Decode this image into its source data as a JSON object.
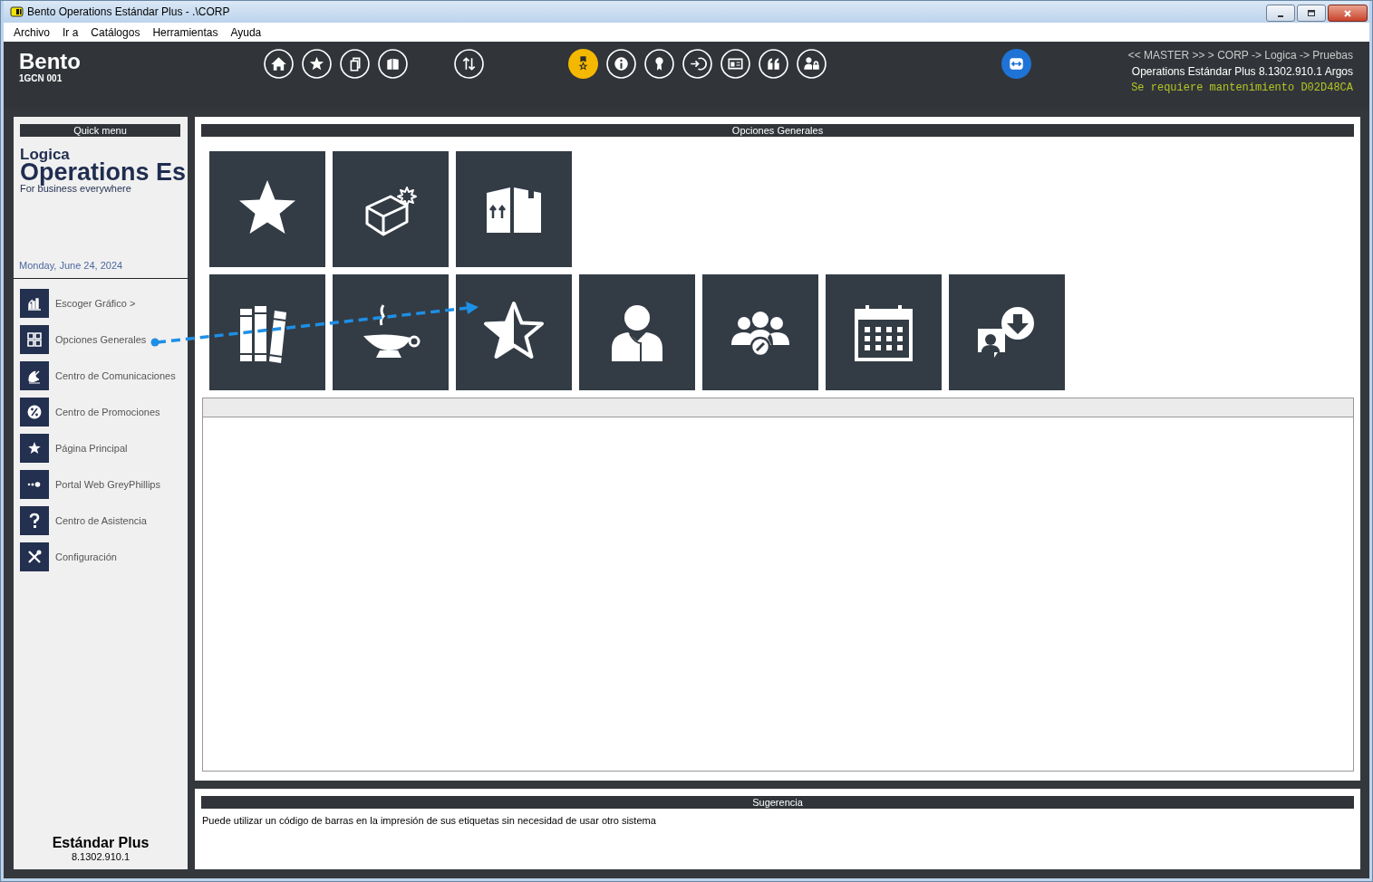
{
  "window": {
    "title": "Bento Operations Estándar Plus - .\\CORP"
  },
  "menu": [
    "Archivo",
    "Ir a",
    "Catálogos",
    "Herramientas",
    "Ayuda"
  ],
  "header": {
    "brand": "Bento",
    "code": "1GCN 001",
    "toolbar": [
      {
        "buttons": [
          {
            "kind": "round",
            "selected": false
          },
          {
            "kind": "round",
            "selected": false
          },
          {
            "kind": "round",
            "selected": false
          },
          {
            "kind": "round",
            "selected": false
          }
        ]
      },
      {
        "buttons": [
          {
            "kind": "round",
            "selected": false
          }
        ]
      },
      {
        "buttons": [
          {
            "kind": "round",
            "selected": true
          },
          {
            "kind": "round",
            "selected": false
          },
          {
            "kind": "round",
            "selected": false
          },
          {
            "kind": "round",
            "selected": false
          },
          {
            "kind": "round",
            "selected": false
          },
          {
            "kind": "round",
            "selected": false
          },
          {
            "kind": "round",
            "selected": false
          }
        ]
      },
      {
        "buttons": [
          {
            "kind": "remote",
            "selected": false
          }
        ]
      }
    ],
    "breadcrumb": "<< MASTER >> > CORP -> Logica -> Pruebas",
    "version": "Operations Estándar Plus 8.1302.910.1 Argos",
    "notice": "Se requiere mantenimiento D02D48CA"
  },
  "sidebar": {
    "title": "Quick menu",
    "logo_small": "Logica",
    "logo_large": "Operations Es",
    "tagline": "For business everywhere",
    "date": "Monday, June 24, 2024",
    "items": [
      {
        "label": "Escoger Gráfico >"
      },
      {
        "label": "Opciones Generales"
      },
      {
        "label": "Centro de Comunicaciones"
      },
      {
        "label": "Centro de Promociones"
      },
      {
        "label": "Página Principal"
      },
      {
        "label": "Portal Web GreyPhillips"
      },
      {
        "label": "Centro de Asistencia"
      },
      {
        "label": "Configuración"
      }
    ],
    "edition": "Estándar Plus",
    "build": "8.1302.910.1"
  },
  "main": {
    "title": "Opciones Generales",
    "tile_rows": [
      [
        {
          "kind": "star"
        },
        {
          "kind": "new-box"
        },
        {
          "kind": "boxes"
        }
      ],
      [
        {
          "kind": "books"
        },
        {
          "kind": "lamp"
        },
        {
          "kind": "half-star"
        },
        {
          "kind": "person"
        },
        {
          "kind": "group"
        },
        {
          "kind": "calendar"
        },
        {
          "kind": "chat-download"
        }
      ]
    ]
  },
  "suggestion": {
    "title": "Sugerencia",
    "text": "Puede utilizar un código de barras en la impresión de sus etiquetas sin necesidad de usar otro sistema"
  }
}
